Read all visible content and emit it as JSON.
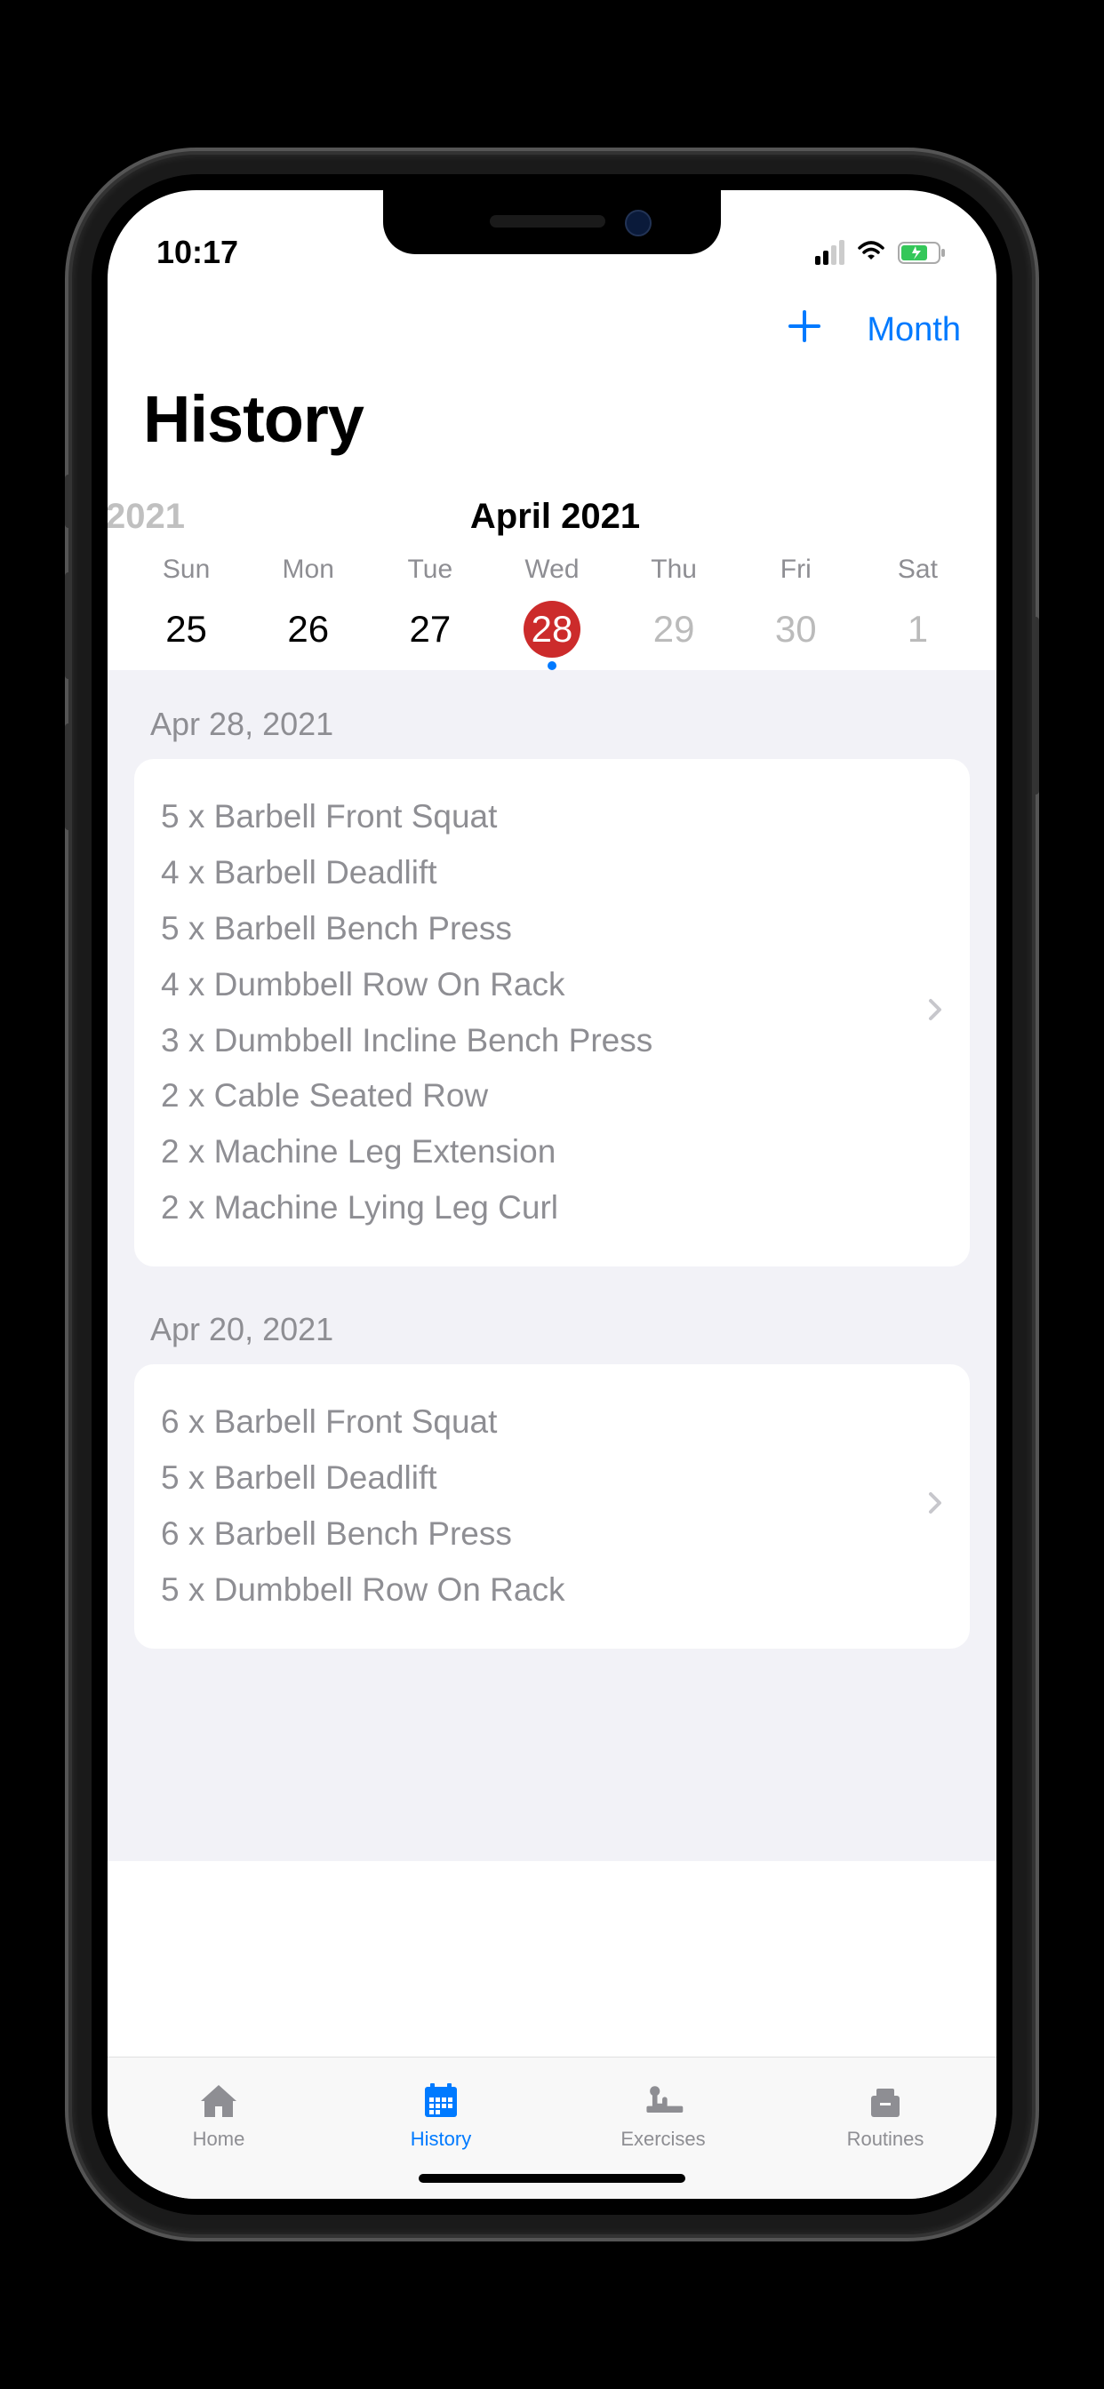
{
  "status": {
    "time": "10:17"
  },
  "nav": {
    "month_button": "Month"
  },
  "title": "History",
  "calendar": {
    "year_hint": "2021",
    "month_label": "April 2021",
    "day_names": [
      "Sun",
      "Mon",
      "Tue",
      "Wed",
      "Thu",
      "Fri",
      "Sat"
    ],
    "days": [
      {
        "num": "25",
        "selected": false,
        "disabled": false,
        "dot": false
      },
      {
        "num": "26",
        "selected": false,
        "disabled": false,
        "dot": false
      },
      {
        "num": "27",
        "selected": false,
        "disabled": false,
        "dot": false
      },
      {
        "num": "28",
        "selected": true,
        "disabled": false,
        "dot": true
      },
      {
        "num": "29",
        "selected": false,
        "disabled": true,
        "dot": false
      },
      {
        "num": "30",
        "selected": false,
        "disabled": true,
        "dot": false
      },
      {
        "num": "1",
        "selected": false,
        "disabled": true,
        "dot": false
      }
    ]
  },
  "sections": [
    {
      "date": "Apr 28, 2021",
      "items": [
        "5 x Barbell Front Squat",
        "4 x Barbell Deadlift",
        "5 x Barbell Bench Press",
        "4 x Dumbbell Row On Rack",
        "3 x Dumbbell Incline Bench Press",
        "2 x Cable Seated Row",
        "2 x Machine Leg Extension",
        "2 x Machine Lying Leg Curl"
      ]
    },
    {
      "date": "Apr 20, 2021",
      "items": [
        "6 x Barbell Front Squat",
        "5 x Barbell Deadlift",
        "6 x Barbell Bench Press",
        "5 x Dumbbell Row On Rack"
      ]
    }
  ],
  "tabs": [
    {
      "label": "Home",
      "active": false
    },
    {
      "label": "History",
      "active": true
    },
    {
      "label": "Exercises",
      "active": false
    },
    {
      "label": "Routines",
      "active": false
    }
  ]
}
